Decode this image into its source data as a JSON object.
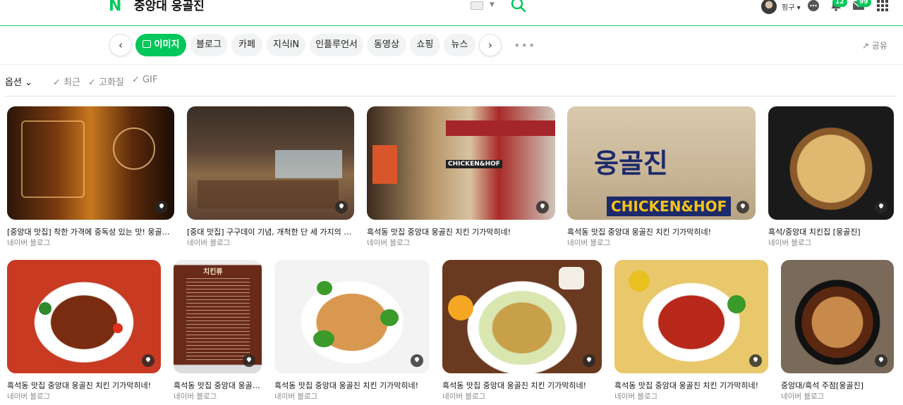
{
  "header": {
    "logo": "N",
    "query": "중앙대 웅골진",
    "user_name": "핑구",
    "notification_count": "12",
    "mail_count": "99"
  },
  "tabs": {
    "items": [
      {
        "label": "이미지",
        "active": true
      },
      {
        "label": "블로그",
        "active": false
      },
      {
        "label": "카페",
        "active": false
      },
      {
        "label": "지식iN",
        "active": false
      },
      {
        "label": "인플루언서",
        "active": false
      },
      {
        "label": "동영상",
        "active": false
      },
      {
        "label": "쇼핑",
        "active": false
      },
      {
        "label": "뉴스",
        "active": false
      }
    ],
    "share_label": "공유"
  },
  "options": {
    "label": "옵션",
    "filters": [
      "최근",
      "고화질",
      "GIF"
    ]
  },
  "results": [
    {
      "title": "[중앙대 맛집] 착한 가격에 중독성 있는 맛! 웅골진 치킨",
      "source": "네이버 블로그"
    },
    {
      "title": "[중대 맛집] 구구데이 기념, 개척한 단 세 가지의 치킨...",
      "source": "네이버 블로그"
    },
    {
      "title": "흑석동 맛집 중앙대 웅골진 치킨 기가막히네!",
      "source": "네이버 블로그"
    },
    {
      "title": "흑석동 맛집 중앙대 웅골진 치킨 기가막히네!",
      "source": "네이버 블로그"
    },
    {
      "title": "흑석/중앙대 치킨집 [웅골진]",
      "source": "네이버 블로그"
    },
    {
      "title": "흑석동 맛집 중앙대 웅골진 치킨 기가막히네!",
      "source": "네이버 블로그"
    },
    {
      "title": "흑석동 맛집 중앙대 웅골진...",
      "source": "네이버 블로그"
    },
    {
      "title": "흑석동 맛집 중앙대 웅골진 치킨 기가막히네!",
      "source": "네이버 블로그"
    },
    {
      "title": "흑석동 맛집 중앙대 웅골진 치킨 기가막히네!",
      "source": "네이버 블로그"
    },
    {
      "title": "흑석동 맛집 중앙대 웅골진 치킨 기가막히네!",
      "source": "네이버 블로그"
    },
    {
      "title": "중앙대/흑석 주점[웅골진]",
      "source": "네이버 블로그"
    }
  ],
  "thumb_text": {
    "sign_brand": "웅골진",
    "sign_sub": "CHICKEN&HOF",
    "store_sub": "CHICKEN&HOF",
    "menu_header": "치킨류"
  },
  "colors": {
    "brand": "#03c75a"
  }
}
